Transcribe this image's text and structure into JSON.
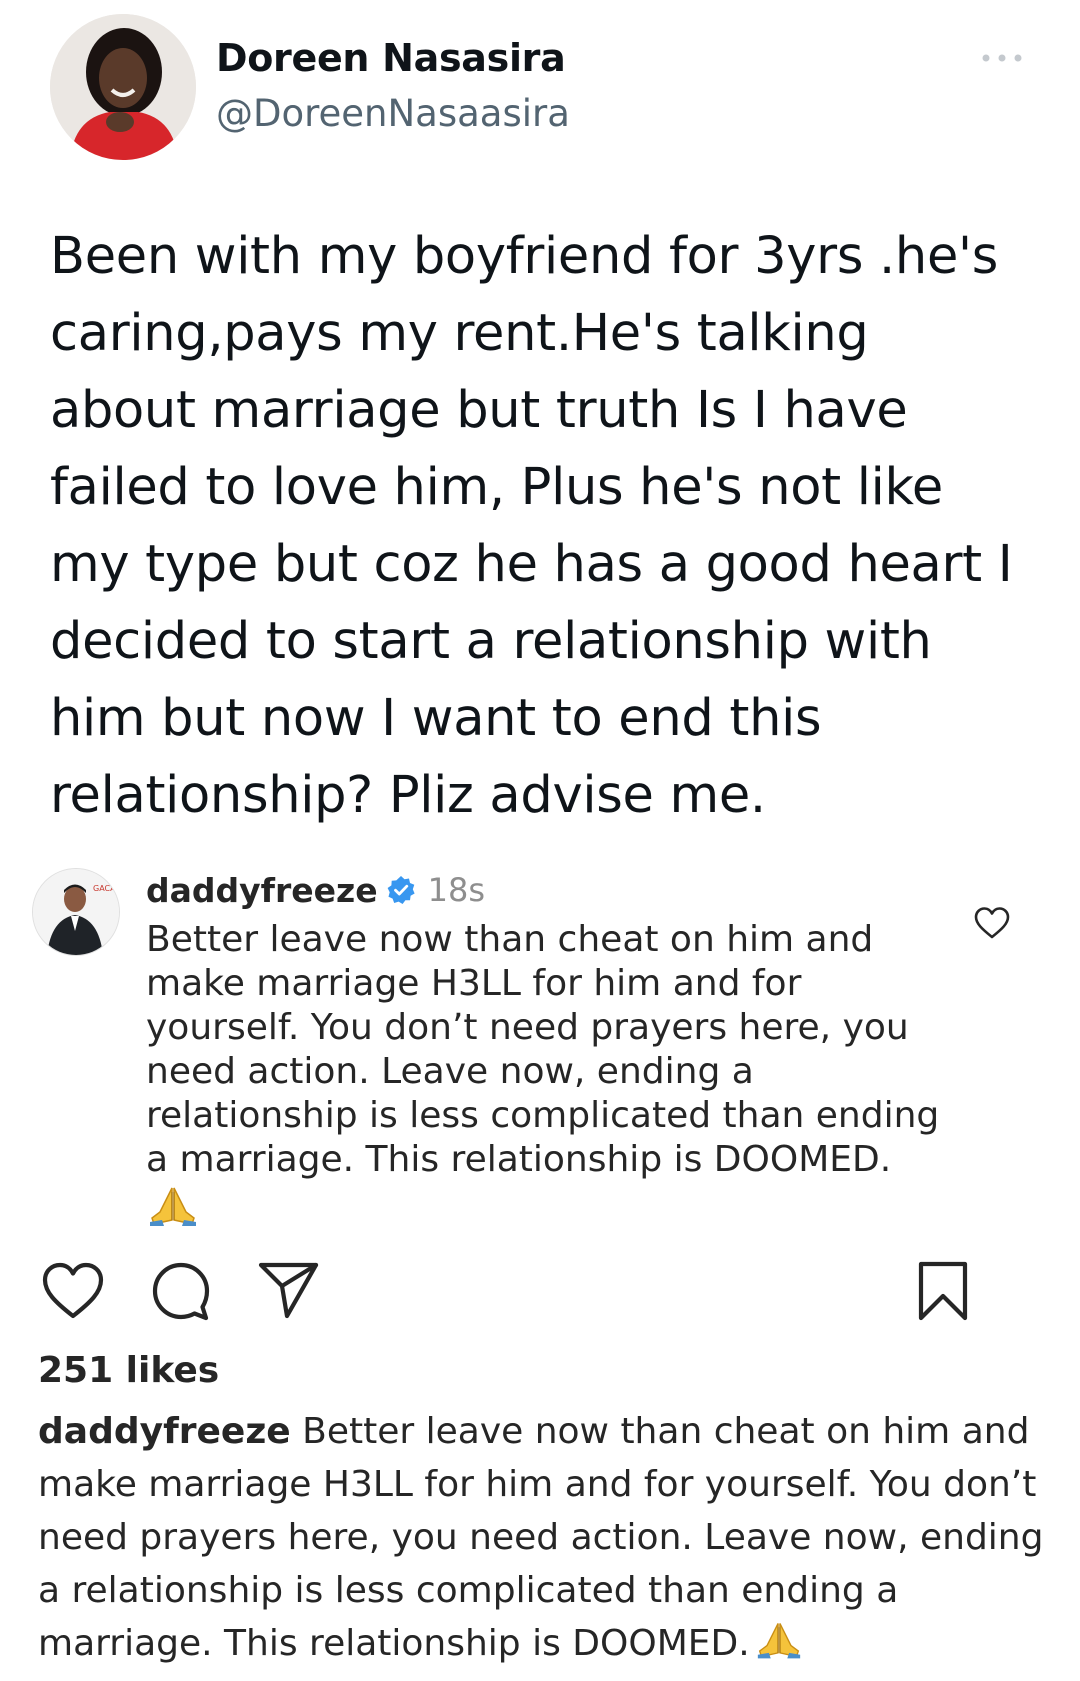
{
  "tweet": {
    "display_name": "Doreen Nasasira",
    "handle": "@DoreenNasaasira",
    "text": "Been with my boyfriend for 3yrs .he's\ncaring,pays my rent.He's talking\nabout marriage but truth Is I have\nfailed to love him, Plus he's not like\nmy type but coz he has a good heart I\ndecided to start a relationship with\nhim but now I want to end this\nrelationship? Pliz advise me.",
    "more_icon": "more-horizontal-icon",
    "avatar_icon": "profile-photo"
  },
  "comment": {
    "username": "daddyfreeze",
    "verified_icon": "verified-badge-icon",
    "time": "18s",
    "text": "Better leave now than cheat on him and\nmake marriage H3LL for him and for\nyourself. You don’t need prayers here, you\nneed action. Leave now, ending a\nrelationship is less complicated than ending\na marriage. This relationship is DOOMED.",
    "emoji_icon": "folded-hands-emoji",
    "like_icon": "heart-outline-icon",
    "avatar_icon": "profile-photo"
  },
  "actions": {
    "like_icon": "heart-outline-icon",
    "comment_icon": "comment-bubble-icon",
    "share_icon": "paper-plane-icon",
    "save_icon": "bookmark-icon"
  },
  "likes": "251 likes",
  "caption": {
    "username": "daddyfreeze",
    "text": "Better leave now than cheat on him and make marriage H3LL for him and for yourself. You don’t need prayers here, you need action. Leave now, ending a relationship is less complicated than ending a marriage. This relationship is DOOMED.",
    "emoji_icon": "folded-hands-emoji"
  },
  "colors": {
    "text_primary": "#0f1419",
    "text_secondary": "#536471",
    "ig_text": "#262626",
    "ig_muted": "#8e8e8e",
    "verified_blue": "#3897f0",
    "emoji_yellow": "#f5c33b"
  }
}
